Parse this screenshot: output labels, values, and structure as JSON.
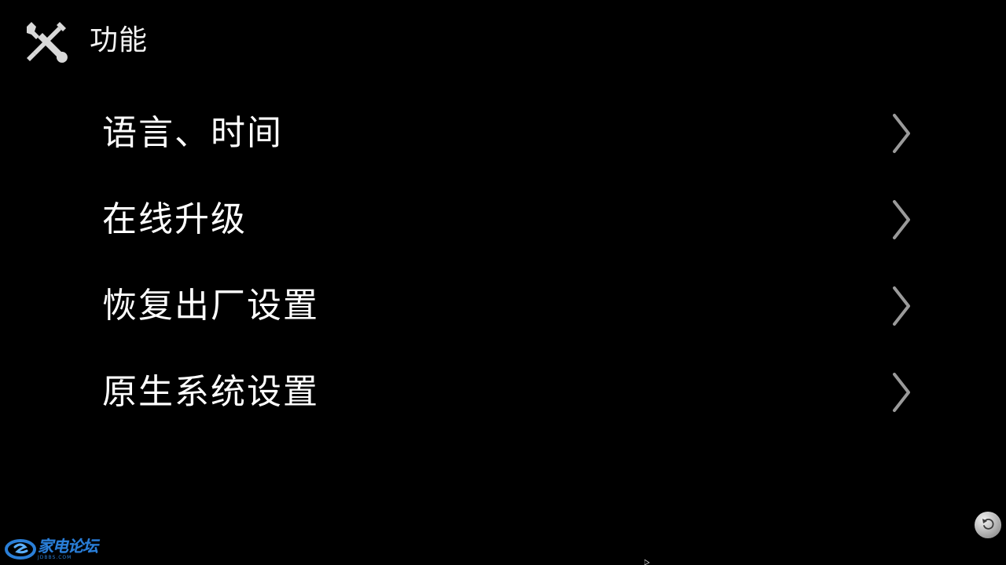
{
  "header": {
    "icon": "tools-icon",
    "title": "功能"
  },
  "menu": {
    "items": [
      {
        "label": "语言、时间",
        "icon": "chevron-right-icon"
      },
      {
        "label": "在线升级",
        "icon": "chevron-right-icon"
      },
      {
        "label": "恢复出厂设置",
        "icon": "chevron-right-icon"
      },
      {
        "label": "原生系统设置",
        "icon": "chevron-right-icon"
      }
    ]
  },
  "footer": {
    "back_icon": "back-icon",
    "watermark_text": "家电论坛",
    "watermark_sub": "JDBBS.COM"
  },
  "colors": {
    "background": "#000000",
    "text": "#ffffff",
    "chevron": "#9a9a9a",
    "watermark": "#2a7fd8"
  }
}
